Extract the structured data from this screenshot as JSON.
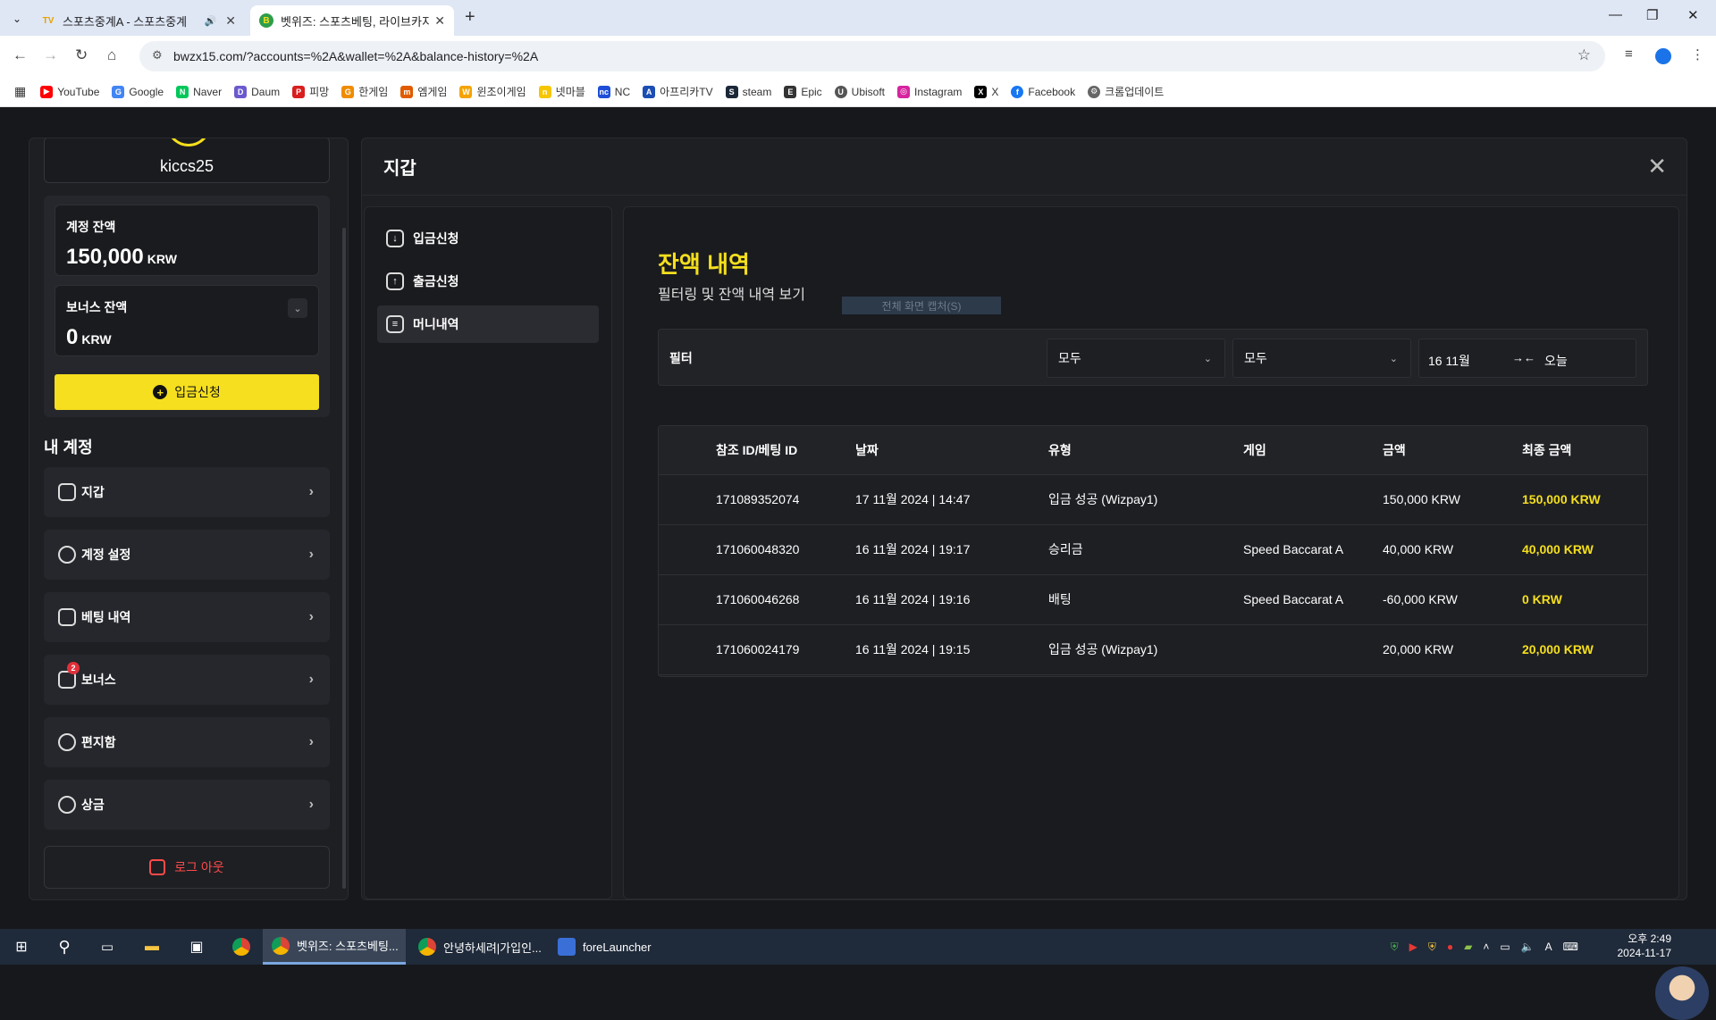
{
  "browser": {
    "tabs": [
      {
        "title": "스포츠중계A - 스포츠중계",
        "icon": "tv-favicon",
        "active": false
      },
      {
        "title": "벳위즈: 스포츠베팅, 라이브카지노",
        "icon": "betwiz-favicon",
        "active": true
      }
    ],
    "url": "bwzx15.com/?accounts=%2A&wallet=%2A&balance-history=%2A",
    "bookmarks": [
      "YouTube",
      "Google",
      "Naver",
      "Daum",
      "피망",
      "한게임",
      "엠게임",
      "윈조이게임",
      "넷마블",
      "NC",
      "아프리카TV",
      "steam",
      "Epic",
      "Ubisoft",
      "Instagram",
      "X",
      "Facebook",
      "크롬업데이트"
    ]
  },
  "sidebar": {
    "username": "kiccs25",
    "account_balance": {
      "label": "계정 잔액",
      "value": "150,000",
      "currency": "KRW"
    },
    "bonus_balance": {
      "label": "보너스 잔액",
      "value": "0",
      "currency": "KRW"
    },
    "deposit_button": "입금신청",
    "my_account_heading": "내 계정",
    "menu": [
      {
        "label": "지갑",
        "icon": "wallet-icon"
      },
      {
        "label": "계정 설정",
        "icon": "user-settings-icon"
      },
      {
        "label": "베팅 내역",
        "icon": "receipt-icon"
      },
      {
        "label": "보너스",
        "icon": "gift-icon",
        "badge": "2"
      },
      {
        "label": "편지함",
        "icon": "message-icon"
      },
      {
        "label": "상금",
        "icon": "award-icon"
      }
    ],
    "logout": "로그 아웃"
  },
  "wallet": {
    "title": "지갑",
    "nav": [
      {
        "label": "입금신청",
        "icon": "download-icon"
      },
      {
        "label": "출금신청",
        "icon": "upload-icon"
      },
      {
        "label": "머니내역",
        "icon": "history-icon",
        "selected": true
      }
    ],
    "content": {
      "title": "잔액 내역",
      "subtitle": "필터링 및 잔액 내역 보기",
      "tooltip": "전체 화면 캡처(S)",
      "filter": {
        "label": "필터",
        "select1": "모두",
        "select2": "모두",
        "date_from": "16 11월",
        "date_to": "오늘"
      },
      "table": {
        "headers": [
          "참조 ID/베팅 ID",
          "날짜",
          "유형",
          "게임",
          "금액",
          "최종 금액"
        ],
        "rows": [
          [
            "171089352074",
            "17 11월 2024 | 14:47",
            "입금 성공 (Wizpay1)",
            "",
            "150,000 KRW",
            "150,000 KRW"
          ],
          [
            "171060048320",
            "16 11월 2024 | 19:17",
            "승리금",
            "Speed Baccarat A",
            "40,000 KRW",
            "40,000 KRW"
          ],
          [
            "171060046268",
            "16 11월 2024 | 19:16",
            "배팅",
            "Speed Baccarat A",
            "-60,000 KRW",
            "0 KRW"
          ],
          [
            "171060024179",
            "16 11월 2024 | 19:15",
            "입금 성공 (Wizpay1)",
            "",
            "20,000 KRW",
            "20,000 KRW"
          ]
        ]
      }
    }
  },
  "taskbar": {
    "apps": [
      {
        "label": "벳위즈: 스포츠베팅...",
        "active": true
      },
      {
        "label": "안녕하세려|가입인...",
        "active": false
      },
      {
        "label": "foreLauncher",
        "active": false
      }
    ],
    "time": "오후 2:49",
    "date": "2024-11-17"
  },
  "colors": {
    "accent": "#f5df1e",
    "danger": "#ff4a4a",
    "background": "#17181b",
    "panel": "#1e1f23"
  }
}
